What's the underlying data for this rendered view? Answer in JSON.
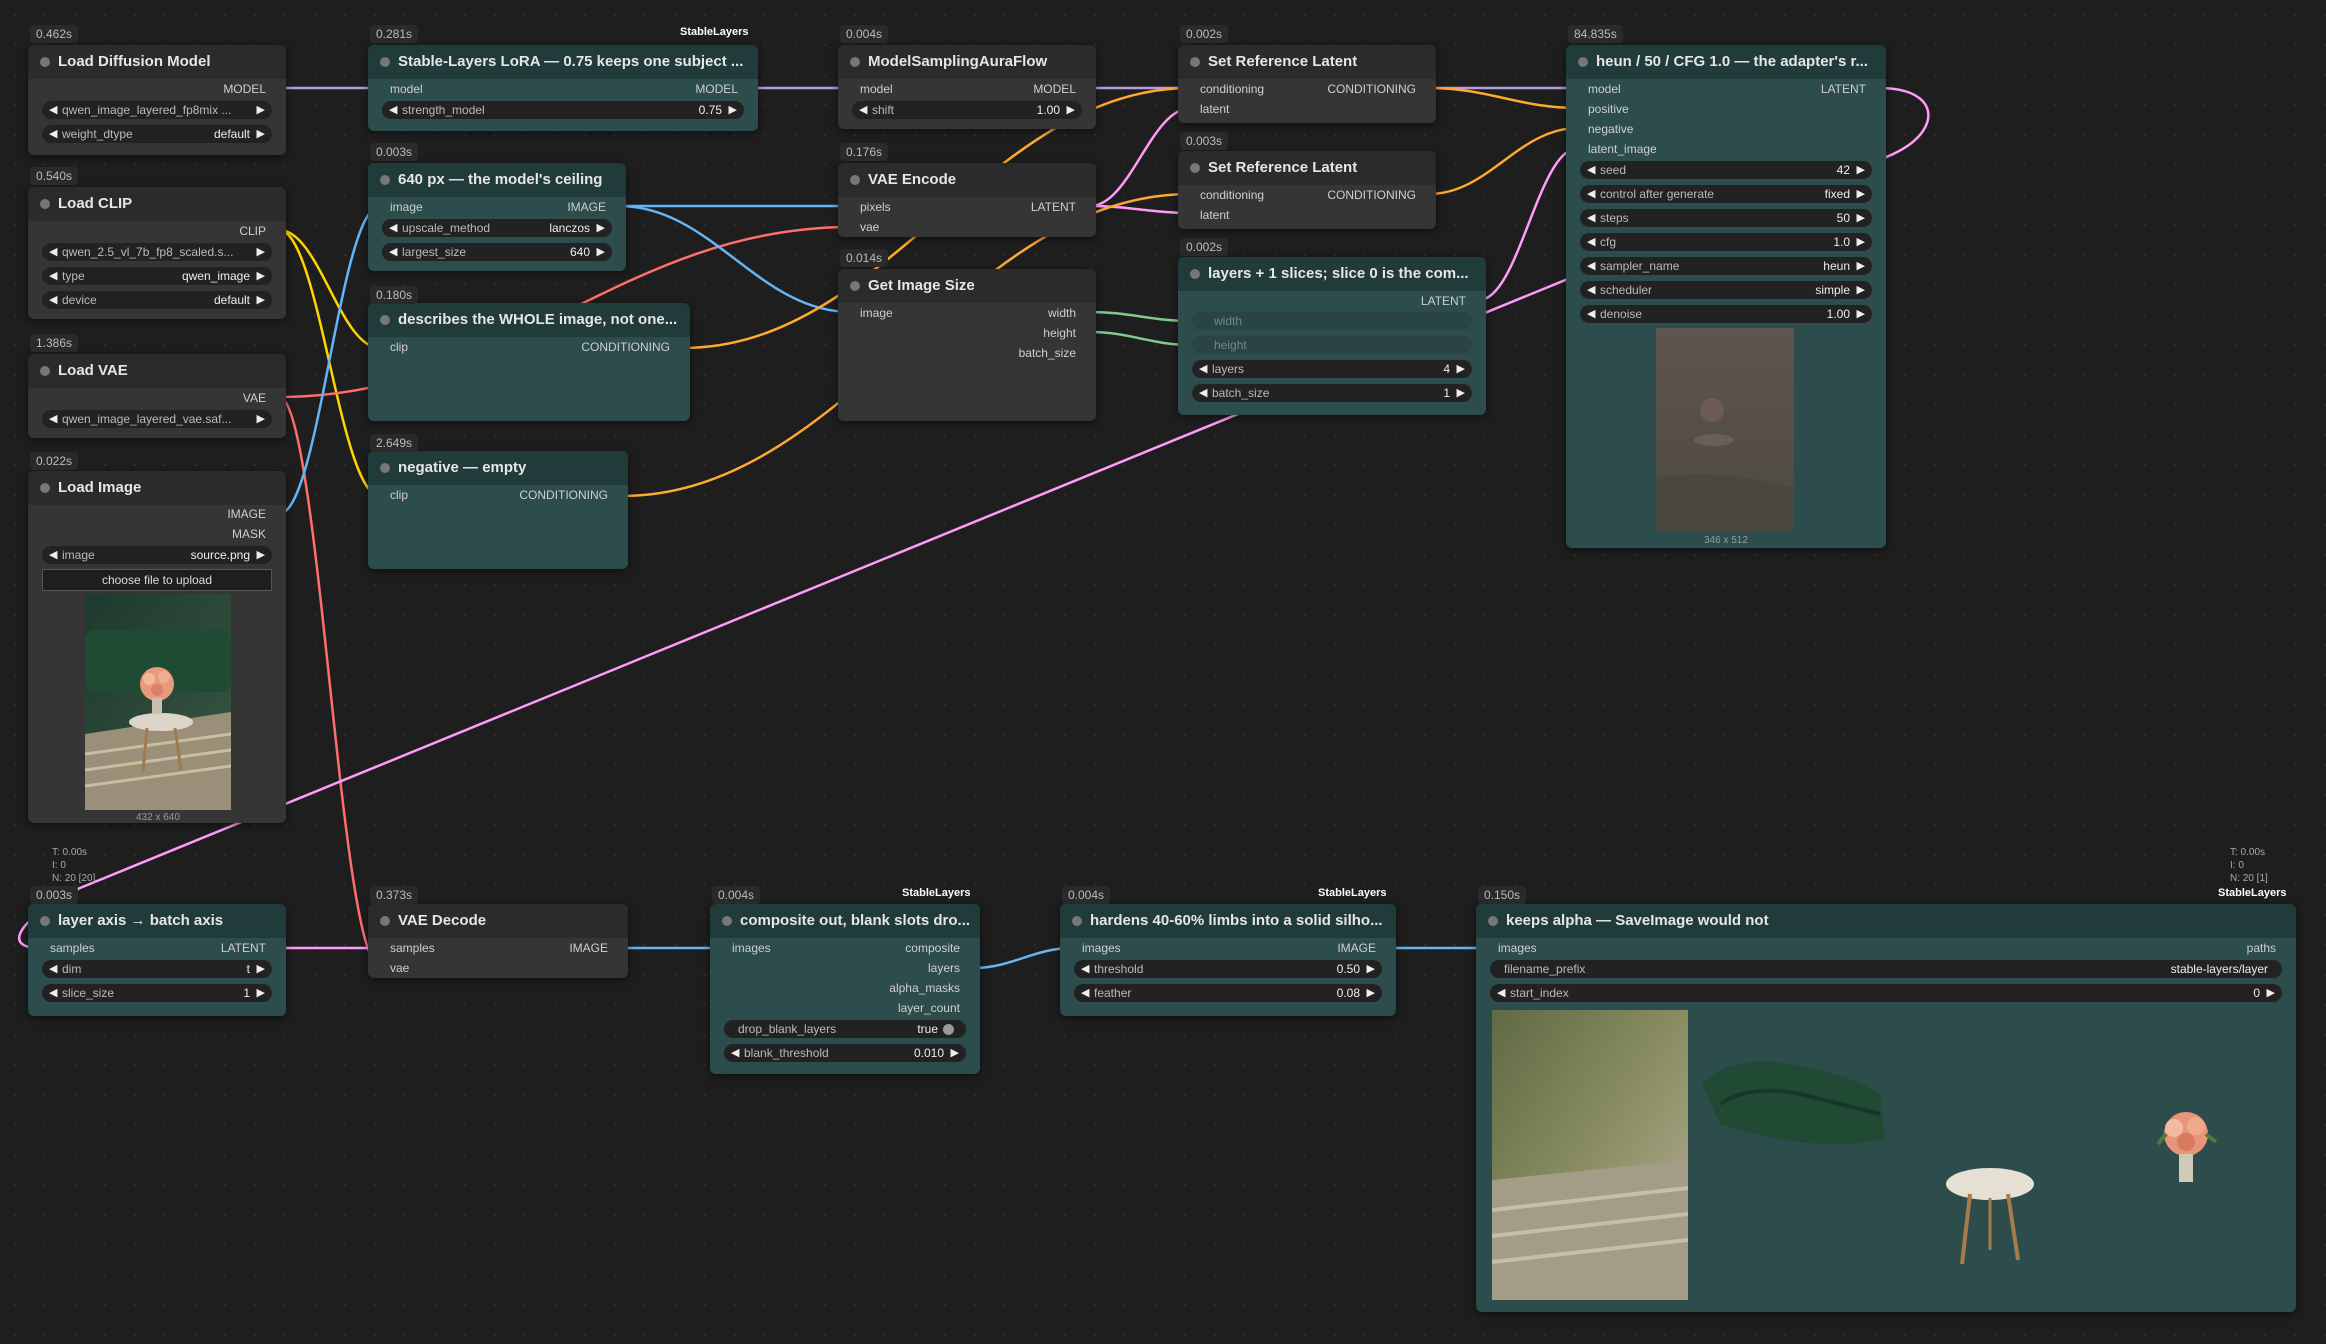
{
  "nodes": {
    "load_diffusion": {
      "time": "0.462s",
      "title": "Load Diffusion Model",
      "outputs": [
        "MODEL"
      ],
      "widgets": [
        {
          "label": "",
          "value": "qwen_image_layered_fp8mix ..."
        },
        {
          "label": "weight_dtype",
          "value": "default"
        }
      ]
    },
    "lora": {
      "time": "0.281s",
      "tag": "StableLayers",
      "title": "Stable-Layers LoRA — 0.75 keeps one subject ...",
      "inputs": [
        "model"
      ],
      "outputs": [
        "MODEL"
      ],
      "widgets": [
        {
          "label": "strength_model",
          "value": "0.75"
        }
      ]
    },
    "model_sampling": {
      "time": "0.004s",
      "title": "ModelSamplingAuraFlow",
      "inputs": [
        "model"
      ],
      "outputs": [
        "MODEL"
      ],
      "widgets": [
        {
          "label": "shift",
          "value": "1.00"
        }
      ]
    },
    "set_ref_1": {
      "time": "0.002s",
      "title": "Set Reference Latent",
      "inputs": [
        "conditioning",
        "latent"
      ],
      "outputs": [
        "CONDITIONING"
      ]
    },
    "set_ref_2": {
      "time": "0.003s",
      "title": "Set Reference Latent",
      "inputs": [
        "conditioning",
        "latent"
      ],
      "outputs": [
        "CONDITIONING"
      ]
    },
    "ksampler": {
      "time": "84.835s",
      "title": "heun / 50 / CFG 1.0 — the adapter's r...",
      "inputs": [
        "model",
        "positive",
        "negative",
        "latent_image"
      ],
      "outputs": [
        "LATENT"
      ],
      "widgets": [
        {
          "label": "seed",
          "value": "42"
        },
        {
          "label": "control after generate",
          "value": "fixed"
        },
        {
          "label": "steps",
          "value": "50"
        },
        {
          "label": "cfg",
          "value": "1.0"
        },
        {
          "label": "sampler_name",
          "value": "heun"
        },
        {
          "label": "scheduler",
          "value": "simple"
        },
        {
          "label": "denoise",
          "value": "1.00"
        }
      ],
      "preview_dim": "346 x 512"
    },
    "load_clip": {
      "time": "0.540s",
      "title": "Load CLIP",
      "outputs": [
        "CLIP"
      ],
      "widgets": [
        {
          "label": "",
          "value": "qwen_2.5_vl_7b_fp8_scaled.s..."
        },
        {
          "label": "type",
          "value": "qwen_image"
        },
        {
          "label": "device",
          "value": "default"
        }
      ]
    },
    "upscale": {
      "time": "0.003s",
      "title": "640 px — the model's ceiling",
      "inputs": [
        "image"
      ],
      "outputs": [
        "IMAGE"
      ],
      "widgets": [
        {
          "label": "upscale_method",
          "value": "lanczos"
        },
        {
          "label": "largest_size",
          "value": "640"
        }
      ]
    },
    "vae_encode": {
      "time": "0.176s",
      "title": "VAE Encode",
      "inputs": [
        "pixels",
        "vae"
      ],
      "outputs": [
        "LATENT"
      ]
    },
    "get_size": {
      "time": "0.014s",
      "title": "Get Image Size",
      "inputs": [
        "image"
      ],
      "outputs": [
        "width",
        "height",
        "batch_size"
      ]
    },
    "empty_latent": {
      "time": "0.002s",
      "title": "layers + 1 slices; slice 0 is the com...",
      "outputs": [
        "LATENT"
      ],
      "disabled": [
        "width",
        "height"
      ],
      "widgets": [
        {
          "label": "layers",
          "value": "4"
        },
        {
          "label": "batch_size",
          "value": "1"
        }
      ]
    },
    "pos_prompt": {
      "time": "0.180s",
      "title": "describes the WHOLE image, not one...",
      "inputs": [
        "clip"
      ],
      "outputs": [
        "CONDITIONING"
      ]
    },
    "load_vae": {
      "time": "1.386s",
      "title": "Load VAE",
      "outputs": [
        "VAE"
      ],
      "widgets": [
        {
          "label": "",
          "value": "qwen_image_layered_vae.saf..."
        }
      ]
    },
    "neg_prompt": {
      "time": "2.649s",
      "title": "negative — empty",
      "inputs": [
        "clip"
      ],
      "outputs": [
        "CONDITIONING"
      ]
    },
    "load_image": {
      "time": "0.022s",
      "title": "Load Image",
      "outputs": [
        "IMAGE",
        "MASK"
      ],
      "widgets": [
        {
          "label": "image",
          "value": "source.png"
        }
      ],
      "button": "choose file to upload",
      "preview_dim": "432 x 640"
    },
    "latent_batch": {
      "time": "0.003s",
      "title": "layer axis → batch axis",
      "inputs": [
        "samples"
      ],
      "outputs": [
        "LATENT"
      ],
      "widgets": [
        {
          "label": "dim",
          "value": "t"
        },
        {
          "label": "slice_size",
          "value": "1"
        }
      ],
      "stats": [
        "T: 0.00s",
        "I: 0",
        "N: 20 [20]"
      ]
    },
    "vae_decode": {
      "time": "0.373s",
      "title": "VAE Decode",
      "inputs": [
        "samples",
        "vae"
      ],
      "outputs": [
        "IMAGE"
      ]
    },
    "composite": {
      "time": "0.004s",
      "tag": "StableLayers",
      "title": "composite out, blank slots dro...",
      "inputs": [
        "images"
      ],
      "outputs": [
        "composite",
        "layers",
        "alpha_masks",
        "layer_count"
      ],
      "widgets": [
        {
          "label": "drop_blank_layers",
          "value": "true"
        },
        {
          "label": "blank_threshold",
          "value": "0.010"
        }
      ]
    },
    "harden": {
      "time": "0.004s",
      "tag": "StableLayers",
      "title": "hardens 40-60% limbs into a solid silho...",
      "inputs": [
        "images"
      ],
      "outputs": [
        "IMAGE"
      ],
      "widgets": [
        {
          "label": "threshold",
          "value": "0.50"
        },
        {
          "label": "feather",
          "value": "0.08"
        }
      ]
    },
    "save": {
      "time": "0.150s",
      "tag": "StableLayers",
      "title": "keeps alpha — SaveImage would not",
      "inputs": [
        "images"
      ],
      "outputs": [
        "paths"
      ],
      "widgets": [
        {
          "label": "filename_prefix",
          "value": "stable-layers/layer"
        },
        {
          "label": "start_index",
          "value": "0"
        }
      ],
      "stats": [
        "T: 0.00s",
        "I: 0",
        "N: 20 [1]"
      ]
    }
  },
  "colors": {
    "model": "#b39ddb",
    "clip": "#ffd500",
    "vae": "#ff6e6e",
    "conditioning": "#ffa931",
    "latent": "#ff9cf9",
    "image": "#64b5f6",
    "int": "#84c98b",
    "mask": "#81c784"
  }
}
